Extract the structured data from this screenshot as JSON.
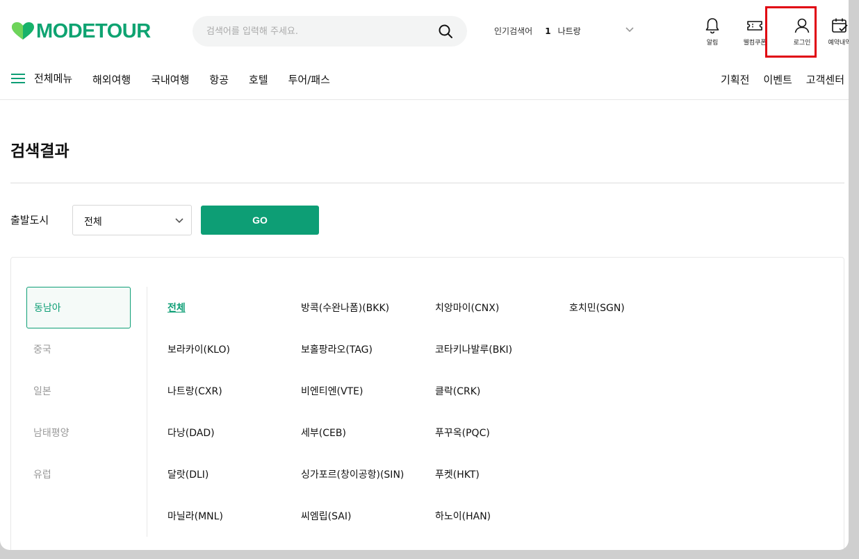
{
  "brand": {
    "name": "MODETOUR",
    "color": "#0ea371"
  },
  "search": {
    "placeholder": "검색어를 입력해 주세요."
  },
  "popular": {
    "label": "인기검색어",
    "rank": "1",
    "keyword": "나트랑"
  },
  "tools": [
    {
      "label": "알림",
      "icon": "bell-icon"
    },
    {
      "label": "웰컴쿠폰",
      "icon": "coupon-icon"
    },
    {
      "label": "로그인",
      "icon": "user-icon"
    },
    {
      "label": "예약내역",
      "icon": "calendar-check-icon"
    }
  ],
  "nav": {
    "menu_label": "전체메뉴",
    "items": [
      "해외여행",
      "국내여행",
      "항공",
      "호텔",
      "투어/패스"
    ],
    "right": [
      "기획전",
      "이벤트",
      "고객센터"
    ]
  },
  "page": {
    "title": "검색결과"
  },
  "filter": {
    "label": "출발도시",
    "selected": "전체",
    "go_label": "GO"
  },
  "regions": [
    "동남아",
    "중국",
    "일본",
    "남태평양",
    "유럽"
  ],
  "active_region": "동남아",
  "cities": [
    "전체",
    "방콕(수완나폼)(BKK)",
    "치앙마이(CNX)",
    "호치민(SGN)",
    "보라카이(KLO)",
    "보홀팡라오(TAG)",
    "코타키나발루(BKI)",
    "",
    "나트랑(CXR)",
    "비엔티엔(VTE)",
    "클락(CRK)",
    "",
    "다낭(DAD)",
    "세부(CEB)",
    "푸꾸옥(PQC)",
    "",
    "달랏(DLI)",
    "싱가포르(창이공항)(SIN)",
    "푸켓(HKT)",
    "",
    "마닐라(MNL)",
    "씨엠립(SAI)",
    "하노이(HAN)",
    ""
  ],
  "colors": {
    "accent": "#0d9e75",
    "highlight": "#e00010"
  }
}
